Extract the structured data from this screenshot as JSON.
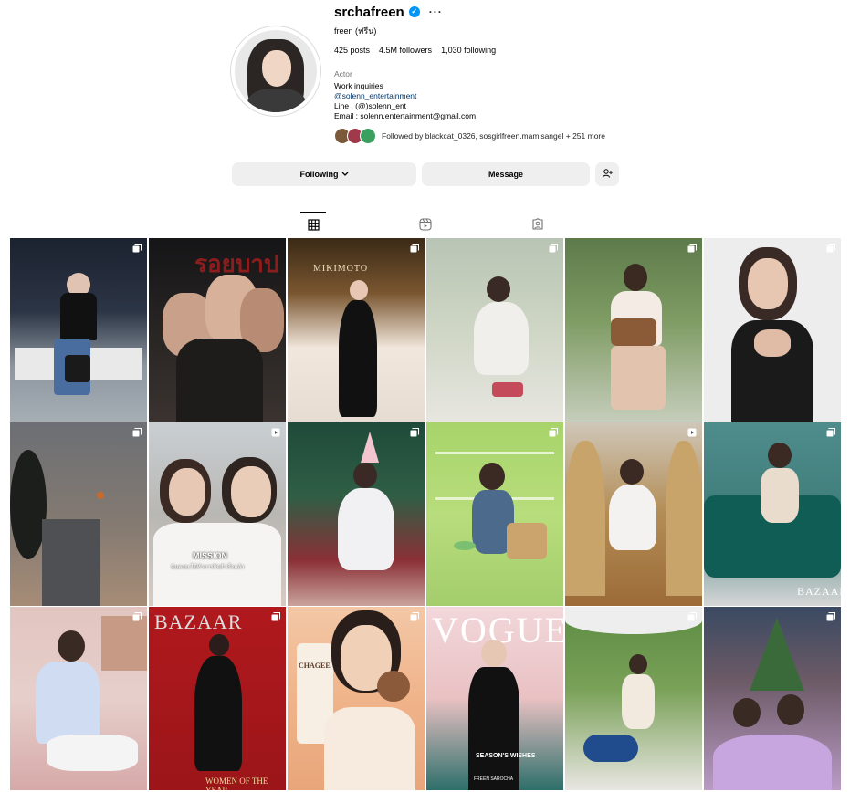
{
  "profile": {
    "username": "srchafreen",
    "more_label": "···",
    "full_name": "freen (ฟรีน)",
    "posts": "425 posts",
    "followers": "4.5M followers",
    "following": "1,030 following",
    "category": "Actor",
    "bio": {
      "line1": "Work inquiries",
      "link": "@solenn_entertainment",
      "line3": "Line : (@)solenn_ent",
      "line4": "Email : solenn.entertainment@gmail.com"
    },
    "followed_by": "Followed by blackcat_0326, sosgirlfreen.mamisangel + 251 more"
  },
  "actions": {
    "following_label": "Following",
    "message_label": "Message"
  },
  "tabs": [
    {
      "icon": "grid-icon",
      "active": true
    },
    {
      "icon": "reels-icon",
      "active": false
    },
    {
      "icon": "tagged-icon",
      "active": false
    }
  ],
  "posts": [
    {
      "type": "carousel",
      "text": ""
    },
    {
      "type": "none",
      "text": "รอยบาป"
    },
    {
      "type": "carousel",
      "text": "MIKIMOTO"
    },
    {
      "type": "carousel",
      "text": ""
    },
    {
      "type": "carousel",
      "text": ""
    },
    {
      "type": "carousel",
      "text": ""
    },
    {
      "type": "carousel",
      "text": ""
    },
    {
      "type": "reel",
      "text": "MISSION"
    },
    {
      "type": "carousel",
      "text": ""
    },
    {
      "type": "carousel",
      "text": ""
    },
    {
      "type": "reel",
      "text": ""
    },
    {
      "type": "carousel",
      "text": "BAZAAR"
    },
    {
      "type": "carousel",
      "text": ""
    },
    {
      "type": "carousel",
      "text": "BAZAAR"
    },
    {
      "type": "carousel",
      "text": "CHAGEE"
    },
    {
      "type": "none",
      "text": "VOGUE"
    },
    {
      "type": "carousel",
      "text": ""
    },
    {
      "type": "carousel",
      "text": ""
    }
  ],
  "post_extra": {
    "mission_sub": "ฉันคงจะได้ทำภารกิจสำเร็จแล้ว",
    "women_year": "WOMEN OF THE YEAR",
    "seasons_wishes": "SEASON'S WISHES",
    "freen_name": "FREEN SAROCHA"
  },
  "colors": {
    "verified": "#0095f6",
    "button_bg": "#efefef",
    "link": "#00376b"
  }
}
